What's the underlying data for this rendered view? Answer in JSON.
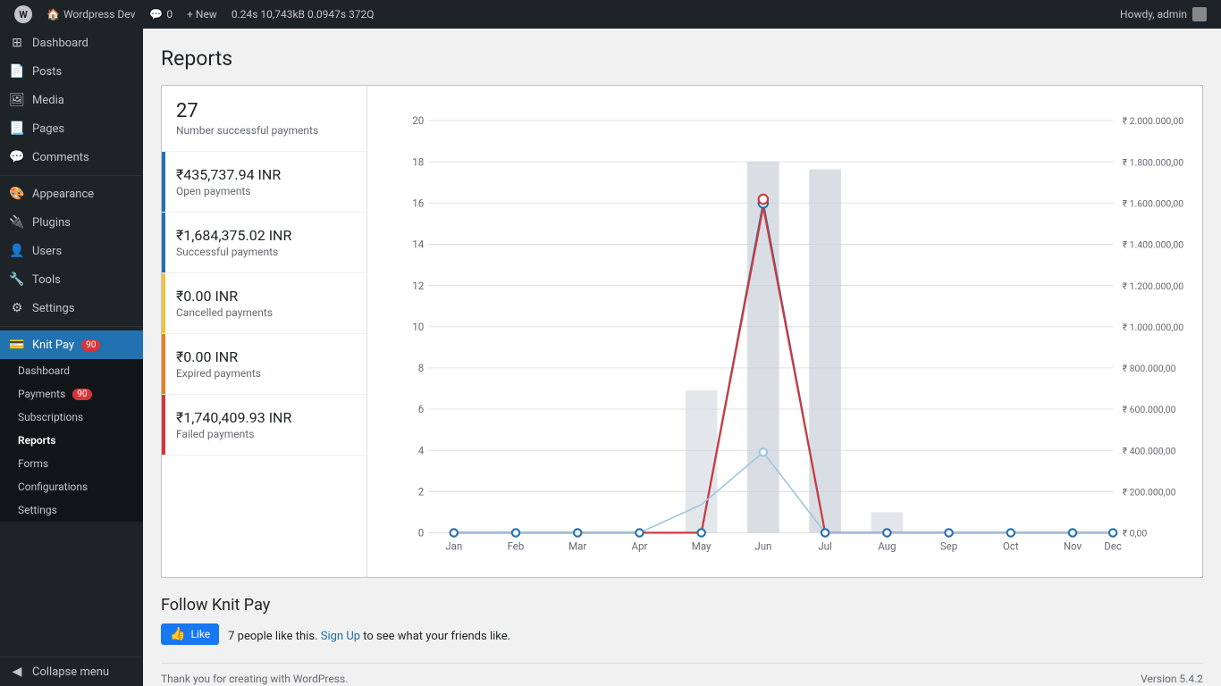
{
  "adminBar": {
    "wpLogo": "W",
    "siteItem": "Wordpress Dev",
    "commentIcon": "💬",
    "commentCount": "0",
    "newItem": "+ New",
    "perfStats": "0.24s  10,743kB  0.0947s  372Q",
    "howdy": "Howdy, admin"
  },
  "sidebar": {
    "items": [
      {
        "id": "dashboard",
        "label": "Dashboard",
        "icon": "⊞"
      },
      {
        "id": "posts",
        "label": "Posts",
        "icon": "📄"
      },
      {
        "id": "media",
        "label": "Media",
        "icon": "🖼"
      },
      {
        "id": "pages",
        "label": "Pages",
        "icon": "📃"
      },
      {
        "id": "comments",
        "label": "Comments",
        "icon": "💬"
      },
      {
        "id": "appearance",
        "label": "Appearance",
        "icon": "🎨"
      },
      {
        "id": "plugins",
        "label": "Plugins",
        "icon": "🔌"
      },
      {
        "id": "users",
        "label": "Users",
        "icon": "👤"
      },
      {
        "id": "tools",
        "label": "Tools",
        "icon": "🔧"
      },
      {
        "id": "settings",
        "label": "Settings",
        "icon": "⚙"
      },
      {
        "id": "knitpay",
        "label": "Knit Pay",
        "icon": "💳",
        "badge": "90"
      }
    ],
    "submenu": [
      {
        "id": "sub-dashboard",
        "label": "Dashboard"
      },
      {
        "id": "sub-payments",
        "label": "Payments",
        "badge": "90"
      },
      {
        "id": "sub-subscriptions",
        "label": "Subscriptions"
      },
      {
        "id": "sub-reports",
        "label": "Reports",
        "active": true
      },
      {
        "id": "sub-forms",
        "label": "Forms"
      },
      {
        "id": "sub-configurations",
        "label": "Configurations"
      },
      {
        "id": "sub-settings",
        "label": "Settings"
      }
    ],
    "collapseLabel": "Collapse menu"
  },
  "page": {
    "title": "Reports"
  },
  "stats": [
    {
      "id": "successful-count",
      "value": "27",
      "label": "Number successful payments",
      "barColor": ""
    },
    {
      "id": "open-payments",
      "value": "₹435,737.94 INR",
      "label": "Open payments",
      "barColor": "blue"
    },
    {
      "id": "successful-payments",
      "value": "₹1,684,375.02 INR",
      "label": "Successful payments",
      "barColor": "blue"
    },
    {
      "id": "cancelled-payments",
      "value": "₹0.00 INR",
      "label": "Cancelled payments",
      "barColor": "yellow"
    },
    {
      "id": "expired-payments",
      "value": "₹0.00 INR",
      "label": "Expired payments",
      "barColor": "orange"
    },
    {
      "id": "failed-payments",
      "value": "₹1,740,409.93 INR",
      "label": "Failed payments",
      "barColor": "red"
    }
  ],
  "chart": {
    "xLabels": [
      "Jan",
      "Feb",
      "Mar",
      "Apr",
      "May",
      "Jun",
      "Jul",
      "Aug",
      "Sep",
      "Oct",
      "Nov",
      "Dec"
    ],
    "yLabelsLeft": [
      "0",
      "2",
      "4",
      "6",
      "8",
      "10",
      "12",
      "14",
      "16",
      "18",
      "20"
    ],
    "yLabelsRight": [
      "₹ 0,00",
      "₹ 200.000,00",
      "₹ 400.000,00",
      "₹ 600.000,00",
      "₹ 800.000,00",
      "₹ 1.000.000,00",
      "₹ 1.200.000,00",
      "₹ 1.400.000,00",
      "₹ 1.600.000,00",
      "₹ 1.800.000,00",
      "₹ 2.000.000,00"
    ]
  },
  "follow": {
    "title": "Follow Knit Pay",
    "fbLikeLabel": "👍 Like",
    "fbText": "7 people like this.",
    "signUpText": "Sign Up",
    "signUpSuffix": " to see what your friends like."
  },
  "footer": {
    "thankYou": "Thank you for creating with WordPress.",
    "version": "Version 5.4.2"
  }
}
